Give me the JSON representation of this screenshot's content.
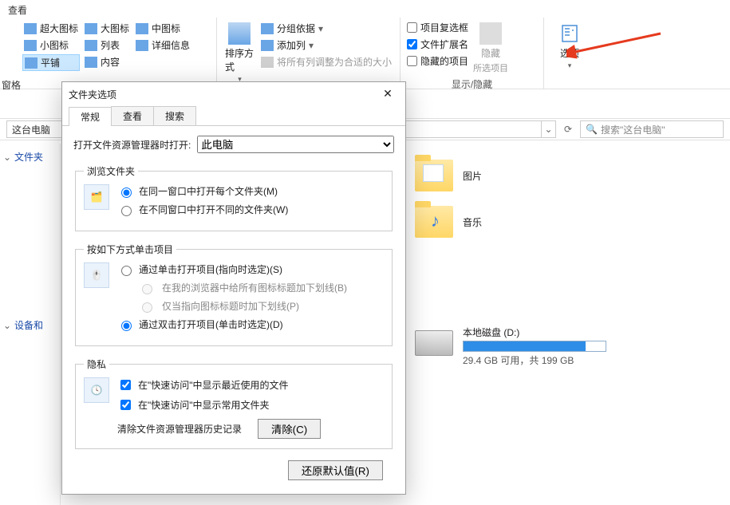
{
  "ribbon": {
    "tab_view": "查看",
    "pane_label": "窗格",
    "layout": {
      "xl_icons": "超大图标",
      "l_icons": "大图标",
      "m_icons": "中图标",
      "s_icons": "小图标",
      "list": "列表",
      "details": "详细信息",
      "tiles": "平铺",
      "content": "内容"
    },
    "sort": {
      "title": "排序方式",
      "group_by": "分组依据",
      "add_col": "添加列",
      "size_all": "将所有列调整为合适的大小"
    },
    "showhide": {
      "chk_boxes": "项目复选框",
      "ext": "文件扩展名",
      "hidden_items": "隐藏的项目",
      "hide": "隐藏",
      "hide_sub": "所选项目",
      "label": "显示/隐藏"
    },
    "options": "选项"
  },
  "search_placeholder": "搜索\"这台电脑\"",
  "crumb": "这台电脑",
  "tree": {
    "folders": "文件夹",
    "devices": "设备和"
  },
  "content_area": {
    "pictures": "图片",
    "music": "音乐",
    "drive_name": "本地磁盘 (D:)",
    "drive_detail": "29.4 GB 可用，共 199 GB",
    "drive_fill_pct": 86
  },
  "dialog": {
    "title": "文件夹选项",
    "tabs": {
      "general": "常规",
      "view": "查看",
      "search": "搜索"
    },
    "open_to_label": "打开文件资源管理器时打开:",
    "open_to_options": [
      "此电脑"
    ],
    "browse": {
      "legend": "浏览文件夹",
      "same_window": "在同一窗口中打开每个文件夹(M)",
      "own_window": "在不同窗口中打开不同的文件夹(W)"
    },
    "click": {
      "legend": "按如下方式单击项目",
      "single": "通过单击打开项目(指向时选定)(S)",
      "underline_browser": "在我的浏览器中给所有图标标题加下划线(B)",
      "underline_point": "仅当指向图标标题时加下划线(P)",
      "double": "通过双击打开项目(单击时选定)(D)"
    },
    "privacy": {
      "legend": "隐私",
      "recent_files": "在\"快速访问\"中显示最近使用的文件",
      "frequent_folders": "在\"快速访问\"中显示常用文件夹",
      "clear_history": "清除文件资源管理器历史记录",
      "clear_btn": "清除(C)"
    },
    "restore_btn": "还原默认值(R)"
  }
}
